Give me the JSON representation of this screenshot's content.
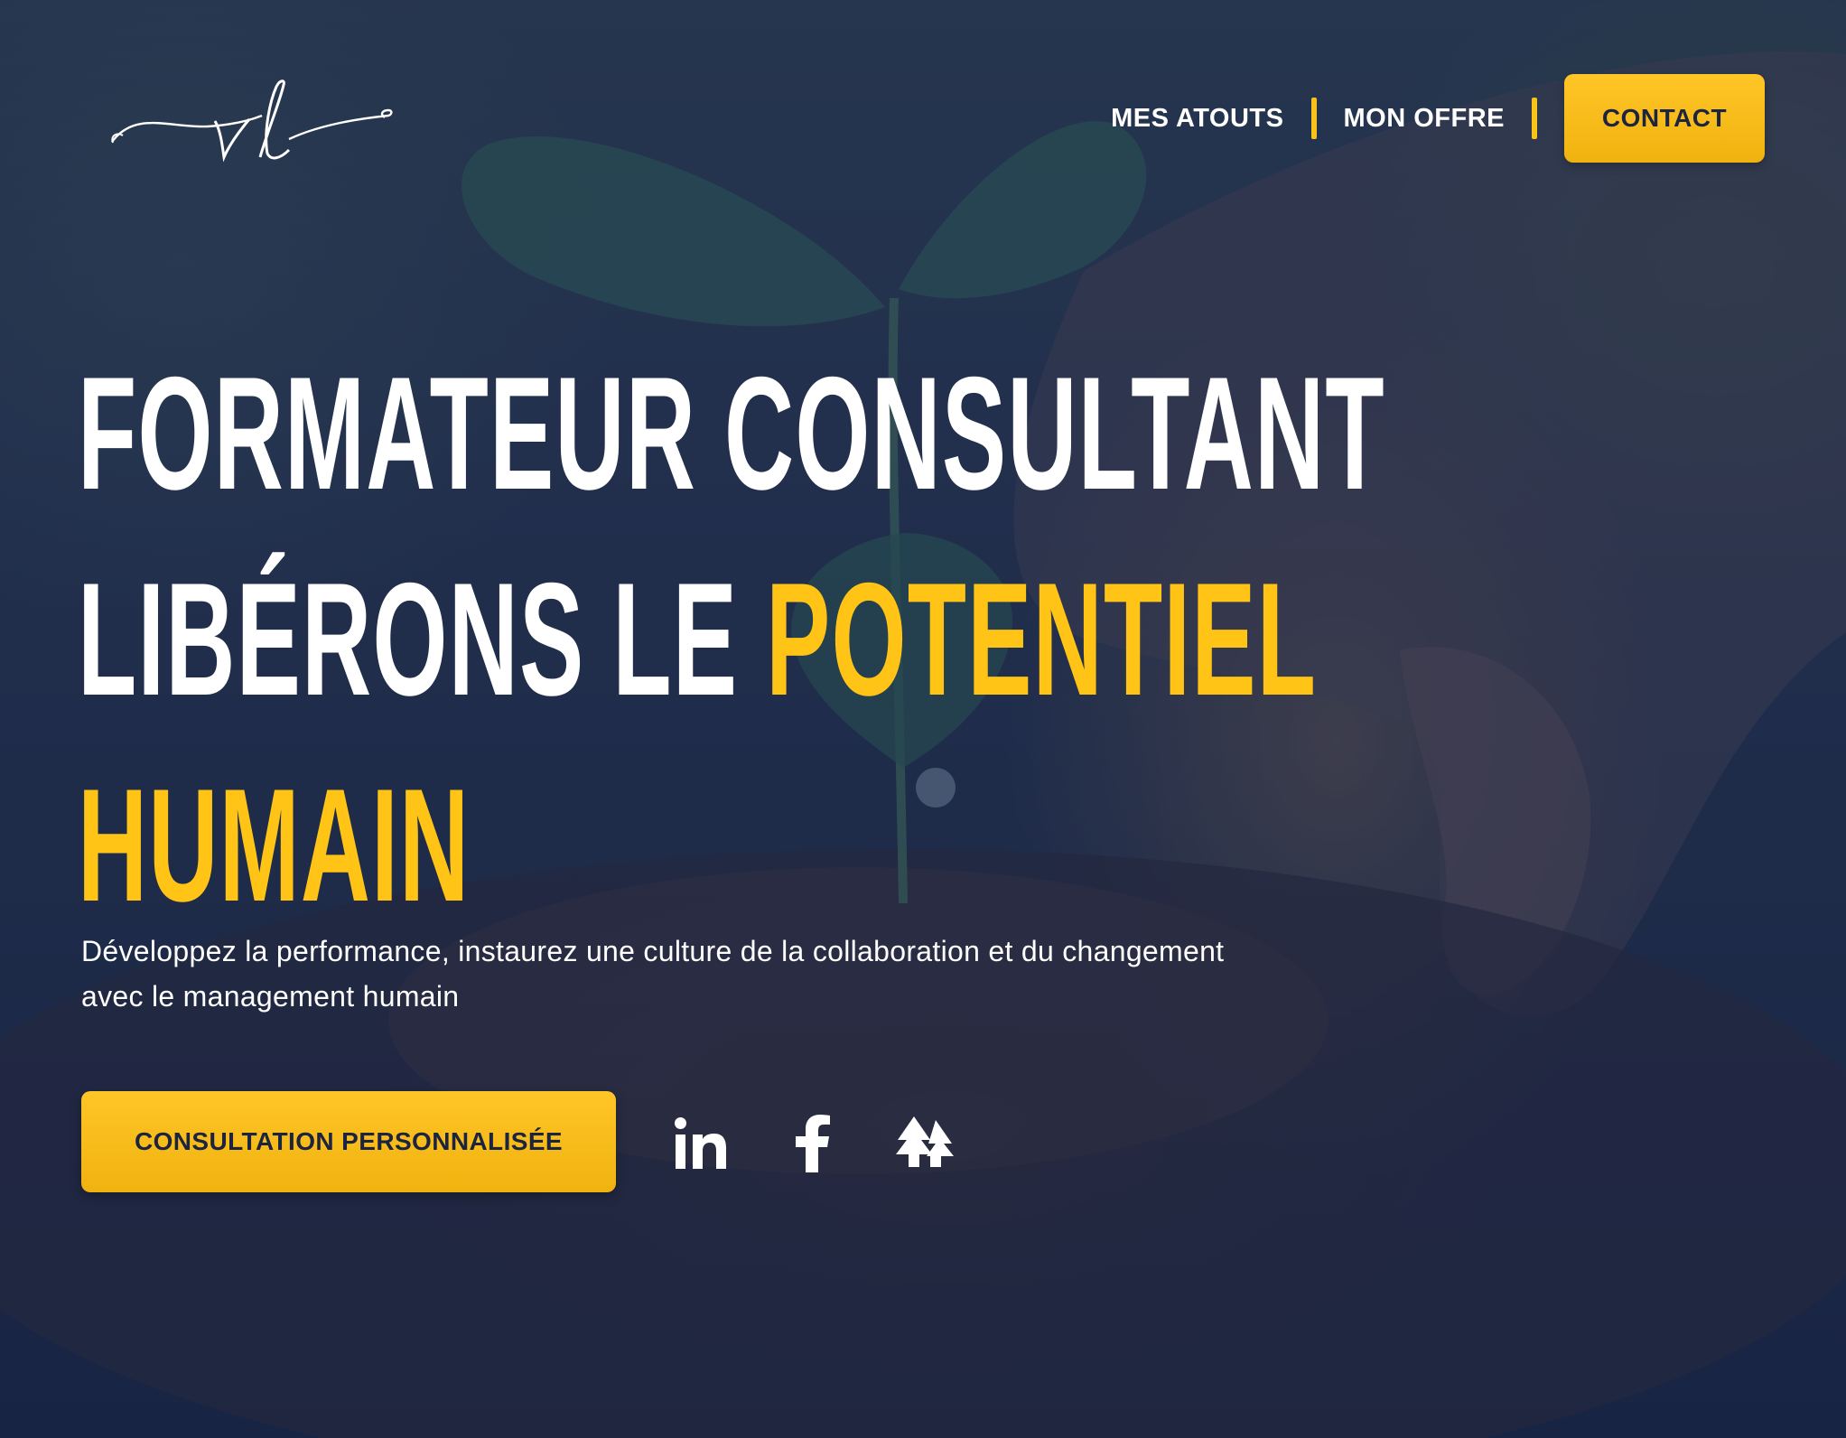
{
  "brand": {
    "logo_text": "vl",
    "accent_color": "#ffc416",
    "dark_color": "#1c2440"
  },
  "nav": {
    "items": [
      {
        "label": "MES ATOUTS"
      },
      {
        "label": "MON OFFRE"
      }
    ],
    "contact_label": "CONTACT"
  },
  "hero": {
    "headline_line1": "FORMATEUR CONSULTANT",
    "headline_line2_plain": "LIBÉRONS LE ",
    "headline_line2_accent": "POTENTIEL",
    "headline_line3_accent": "HUMAIN",
    "subtitle": "Développez la performance, instaurez une culture de la collaboration et du changement avec le management humain",
    "cta_label": "CONSULTATION PERSONNALISÉE"
  },
  "socials": [
    {
      "icon": "linkedin-icon"
    },
    {
      "icon": "facebook-icon"
    },
    {
      "icon": "linktree-icon"
    }
  ]
}
